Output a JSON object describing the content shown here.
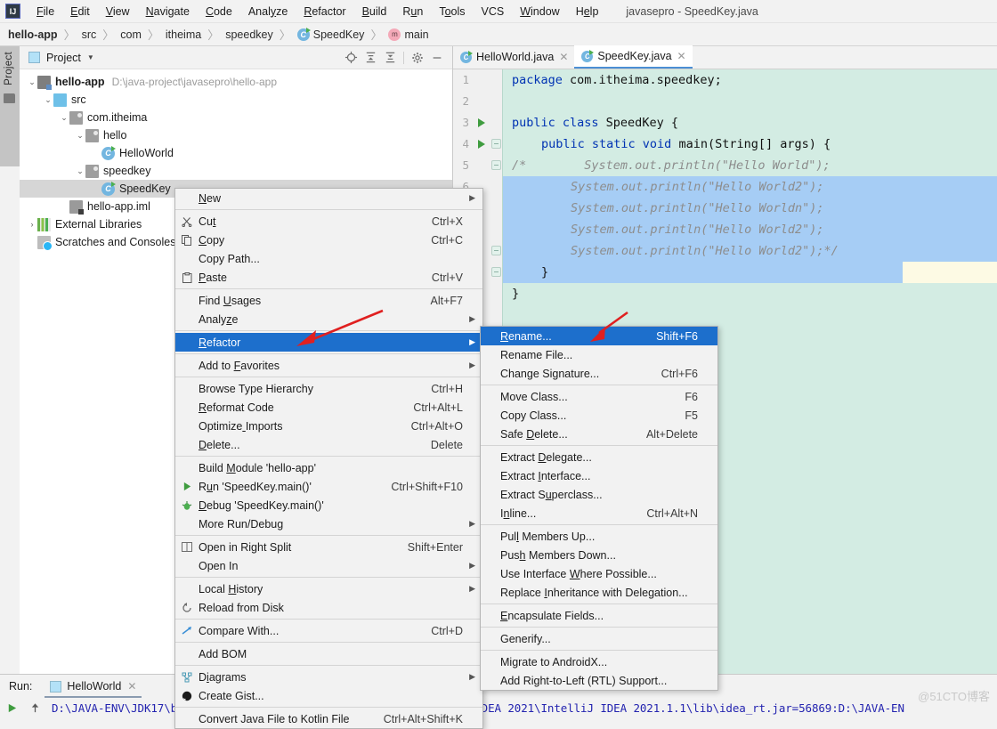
{
  "window": {
    "title": "javasepro - SpeedKey.java",
    "logo_text": "IJ"
  },
  "menubar": {
    "items": [
      {
        "label": "File"
      },
      {
        "label": "Edit"
      },
      {
        "label": "View"
      },
      {
        "label": "Navigate"
      },
      {
        "label": "Code"
      },
      {
        "label": "Analyze"
      },
      {
        "label": "Refactor"
      },
      {
        "label": "Build"
      },
      {
        "label": "Run"
      },
      {
        "label": "Tools"
      },
      {
        "label": "VCS"
      },
      {
        "label": "Window"
      },
      {
        "label": "Help"
      }
    ]
  },
  "breadcrumb": {
    "items": [
      {
        "label": "hello-app",
        "icon": "none",
        "bold": true
      },
      {
        "label": "src",
        "icon": "none",
        "bold": false
      },
      {
        "label": "com",
        "icon": "none",
        "bold": false
      },
      {
        "label": "itheima",
        "icon": "none",
        "bold": false
      },
      {
        "label": "speedkey",
        "icon": "none",
        "bold": false
      },
      {
        "label": "SpeedKey",
        "icon": "class-icon",
        "bold": false
      },
      {
        "label": "main",
        "icon": "method-icon",
        "bold": false
      }
    ]
  },
  "toolwindow_strip": {
    "project_label": "Project"
  },
  "project_panel": {
    "title": "Project",
    "caret": "▼",
    "tools": [
      {
        "name": "locate-icon",
        "glyph": "⊕"
      },
      {
        "name": "expand-all-icon",
        "glyph": "⧉"
      },
      {
        "name": "collapse-all-icon",
        "glyph": "⧉"
      },
      {
        "name": "settings-gear-icon",
        "glyph": "⚙"
      },
      {
        "name": "hide-icon",
        "glyph": "—"
      }
    ],
    "tree": [
      {
        "label": "hello-app",
        "path": "D:\\java-project\\javasepro\\hello-app",
        "indent": 0,
        "arrow": "⌄",
        "icon": "module-folder-icon",
        "bold": true,
        "selected": false
      },
      {
        "label": "src",
        "path": "",
        "indent": 1,
        "arrow": "⌄",
        "icon": "source-folder-icon",
        "bold": false,
        "selected": false
      },
      {
        "label": "com.itheima",
        "path": "",
        "indent": 2,
        "arrow": "⌄",
        "icon": "package-icon",
        "bold": false,
        "selected": false
      },
      {
        "label": "hello",
        "path": "",
        "indent": 3,
        "arrow": "⌄",
        "icon": "package-icon",
        "bold": false,
        "selected": false
      },
      {
        "label": "HelloWorld",
        "path": "",
        "indent": 4,
        "arrow": "",
        "icon": "class-icon",
        "bold": false,
        "selected": false
      },
      {
        "label": "speedkey",
        "path": "",
        "indent": 3,
        "arrow": "⌄",
        "icon": "package-icon",
        "bold": false,
        "selected": false
      },
      {
        "label": "SpeedKey",
        "path": "",
        "indent": 4,
        "arrow": "",
        "icon": "class-icon",
        "bold": false,
        "selected": true
      },
      {
        "label": "hello-app.iml",
        "path": "",
        "indent": 2,
        "arrow": "",
        "icon": "iml-file-icon",
        "bold": false,
        "selected": false
      },
      {
        "label": "External Libraries",
        "path": "",
        "indent": 0,
        "arrow": "›",
        "icon": "libraries-icon",
        "bold": false,
        "selected": false
      },
      {
        "label": "Scratches and Consoles",
        "path": "",
        "indent": 0,
        "arrow": "",
        "icon": "scratches-icon",
        "bold": false,
        "selected": false
      }
    ]
  },
  "editor": {
    "tabs": [
      {
        "label": "HelloWorld.java",
        "active": false,
        "icon": "class-icon"
      },
      {
        "label": "SpeedKey.java",
        "active": true,
        "icon": "class-icon"
      }
    ],
    "line_numbers": [
      "1",
      "2",
      "3",
      "4",
      "5",
      "6"
    ],
    "code": [
      {
        "n": 1,
        "segments": [
          {
            "t": "package",
            "c": "kw"
          },
          {
            "t": " com.itheima.speedkey;",
            "c": "plain"
          }
        ],
        "indent": 0
      },
      {
        "n": 2,
        "segments": [],
        "indent": 0
      },
      {
        "n": 3,
        "segments": [
          {
            "t": "public class",
            "c": "kw"
          },
          {
            "t": " SpeedKey {",
            "c": "plain"
          }
        ],
        "indent": 0
      },
      {
        "n": 4,
        "segments": [
          {
            "t": "public static void",
            "c": "kw"
          },
          {
            "t": " ",
            "c": "plain"
          },
          {
            "t": "main",
            "c": "plain"
          },
          {
            "t": "(String[] args) {",
            "c": "plain"
          }
        ],
        "indent": 1
      },
      {
        "n": 5,
        "segments": [
          {
            "t": "/*        System.out.println(\"Hello World\");",
            "c": "cmt"
          }
        ],
        "indent": 0
      },
      {
        "n": 6,
        "segments": [
          {
            "t": "System.out.println(\"Hello World2\");",
            "c": "cmt"
          }
        ],
        "indent": 2
      },
      {
        "n": 7,
        "segments": [
          {
            "t": "System.out.println(\"Hello Worldn\");",
            "c": "cmt"
          }
        ],
        "indent": 2
      },
      {
        "n": 8,
        "segments": [
          {
            "t": "System.out.println(\"Hello World2\");",
            "c": "cmt"
          }
        ],
        "indent": 2
      },
      {
        "n": 9,
        "segments": [
          {
            "t": "System.out.println(\"Hello World2\");*/",
            "c": "cmt"
          }
        ],
        "indent": 2
      },
      {
        "n": 10,
        "segments": [
          {
            "t": "}",
            "c": "plain"
          }
        ],
        "indent": 1
      },
      {
        "n": 11,
        "segments": [
          {
            "t": "}",
            "c": "plain"
          }
        ],
        "indent": 0
      }
    ]
  },
  "context_menu": {
    "items": [
      {
        "label": "New",
        "accel": "",
        "icon": "",
        "arrow": true,
        "sep_after": true,
        "highlight": false,
        "mn": 0
      },
      {
        "label": "Cut",
        "accel": "Ctrl+X",
        "icon": "✂",
        "arrow": false,
        "sep_after": false,
        "highlight": false,
        "mn": 2
      },
      {
        "label": "Copy",
        "accel": "Ctrl+C",
        "icon": "❐",
        "arrow": false,
        "sep_after": false,
        "highlight": false,
        "mn": 0
      },
      {
        "label": "Copy Path...",
        "accel": "",
        "icon": "",
        "arrow": false,
        "sep_after": false,
        "highlight": false,
        "mn": -1
      },
      {
        "label": "Paste",
        "accel": "Ctrl+V",
        "icon": "⎘",
        "arrow": false,
        "sep_after": true,
        "highlight": false,
        "mn": 0
      },
      {
        "label": "Find Usages",
        "accel": "Alt+F7",
        "icon": "",
        "arrow": false,
        "sep_after": false,
        "highlight": false,
        "mn": 5
      },
      {
        "label": "Analyze",
        "accel": "",
        "icon": "",
        "arrow": true,
        "sep_after": true,
        "highlight": false,
        "mn": 5
      },
      {
        "label": "Refactor",
        "accel": "",
        "icon": "",
        "arrow": true,
        "sep_after": true,
        "highlight": true,
        "mn": 0
      },
      {
        "label": "Add to Favorites",
        "accel": "",
        "icon": "",
        "arrow": true,
        "sep_after": true,
        "highlight": false,
        "mn": 7
      },
      {
        "label": "Browse Type Hierarchy",
        "accel": "Ctrl+H",
        "icon": "",
        "arrow": false,
        "sep_after": false,
        "highlight": false,
        "mn": -1
      },
      {
        "label": "Reformat Code",
        "accel": "Ctrl+Alt+L",
        "icon": "",
        "arrow": false,
        "sep_after": false,
        "highlight": false,
        "mn": 0
      },
      {
        "label": "Optimize Imports",
        "accel": "Ctrl+Alt+O",
        "icon": "",
        "arrow": false,
        "sep_after": false,
        "highlight": false,
        "mn": 8
      },
      {
        "label": "Delete...",
        "accel": "Delete",
        "icon": "",
        "arrow": false,
        "sep_after": true,
        "highlight": false,
        "mn": 0
      },
      {
        "label": "Build Module 'hello-app'",
        "accel": "",
        "icon": "",
        "arrow": false,
        "sep_after": false,
        "highlight": false,
        "mn": 6
      },
      {
        "label": "Run 'SpeedKey.main()'",
        "accel": "Ctrl+Shift+F10",
        "icon": "run-icon",
        "arrow": false,
        "sep_after": false,
        "highlight": false,
        "mn": 1
      },
      {
        "label": "Debug 'SpeedKey.main()'",
        "accel": "",
        "icon": "debug-icon",
        "arrow": false,
        "sep_after": false,
        "highlight": false,
        "mn": 0
      },
      {
        "label": "More Run/Debug",
        "accel": "",
        "icon": "",
        "arrow": true,
        "sep_after": true,
        "highlight": false,
        "mn": -1
      },
      {
        "label": "Open in Right Split",
        "accel": "Shift+Enter",
        "icon": "split-icon",
        "arrow": false,
        "sep_after": false,
        "highlight": false,
        "mn": -1
      },
      {
        "label": "Open In",
        "accel": "",
        "icon": "",
        "arrow": true,
        "sep_after": true,
        "highlight": false,
        "mn": -1
      },
      {
        "label": "Local History",
        "accel": "",
        "icon": "",
        "arrow": true,
        "sep_after": false,
        "highlight": false,
        "mn": 6
      },
      {
        "label": "Reload from Disk",
        "accel": "",
        "icon": "reload-icon",
        "arrow": false,
        "sep_after": true,
        "highlight": false,
        "mn": -1
      },
      {
        "label": "Compare With...",
        "accel": "Ctrl+D",
        "icon": "compare-icon",
        "arrow": false,
        "sep_after": true,
        "highlight": false,
        "mn": -1
      },
      {
        "label": "Add BOM",
        "accel": "",
        "icon": "",
        "arrow": false,
        "sep_after": true,
        "highlight": false,
        "mn": -1
      },
      {
        "label": "Diagrams",
        "accel": "",
        "icon": "diagram-icon",
        "arrow": true,
        "sep_after": false,
        "highlight": false,
        "mn": 1
      },
      {
        "label": "Create Gist...",
        "accel": "",
        "icon": "github-icon",
        "arrow": false,
        "sep_after": true,
        "highlight": false,
        "mn": -1
      },
      {
        "label": "Convert Java File to Kotlin File",
        "accel": "Ctrl+Alt+Shift+K",
        "icon": "",
        "arrow": false,
        "sep_after": false,
        "highlight": false,
        "mn": -1
      }
    ]
  },
  "refactor_submenu": {
    "items": [
      {
        "label": "Rename...",
        "accel": "Shift+F6",
        "arrow": false,
        "sep_after": false,
        "highlight": true,
        "mn": 0
      },
      {
        "label": "Rename File...",
        "accel": "",
        "arrow": false,
        "sep_after": false,
        "highlight": false,
        "mn": -1
      },
      {
        "label": "Change Signature...",
        "accel": "Ctrl+F6",
        "arrow": false,
        "sep_after": true,
        "highlight": false,
        "mn": 9
      },
      {
        "label": "Move Class...",
        "accel": "F6",
        "arrow": false,
        "sep_after": false,
        "highlight": false,
        "mn": -1
      },
      {
        "label": "Copy Class...",
        "accel": "F5",
        "arrow": false,
        "sep_after": false,
        "highlight": false,
        "mn": -1
      },
      {
        "label": "Safe Delete...",
        "accel": "Alt+Delete",
        "arrow": false,
        "sep_after": true,
        "highlight": false,
        "mn": 5
      },
      {
        "label": "Extract Delegate...",
        "accel": "",
        "arrow": false,
        "sep_after": false,
        "highlight": false,
        "mn": 8
      },
      {
        "label": "Extract Interface...",
        "accel": "",
        "arrow": false,
        "sep_after": false,
        "highlight": false,
        "mn": 8
      },
      {
        "label": "Extract Superclass...",
        "accel": "",
        "arrow": false,
        "sep_after": false,
        "highlight": false,
        "mn": 9
      },
      {
        "label": "Inline...",
        "accel": "Ctrl+Alt+N",
        "arrow": false,
        "sep_after": true,
        "highlight": false,
        "mn": 1
      },
      {
        "label": "Pull Members Up...",
        "accel": "",
        "arrow": false,
        "sep_after": false,
        "highlight": false,
        "mn": 3
      },
      {
        "label": "Push Members Down...",
        "accel": "",
        "arrow": false,
        "sep_after": false,
        "highlight": false,
        "mn": 3
      },
      {
        "label": "Use Interface Where Possible...",
        "accel": "",
        "arrow": false,
        "sep_after": false,
        "highlight": false,
        "mn": 14
      },
      {
        "label": "Replace Inheritance with Delegation...",
        "accel": "",
        "arrow": false,
        "sep_after": true,
        "highlight": false,
        "mn": 8
      },
      {
        "label": "Encapsulate Fields...",
        "accel": "",
        "arrow": false,
        "sep_after": true,
        "highlight": false,
        "mn": 0
      },
      {
        "label": "Generify...",
        "accel": "",
        "arrow": false,
        "sep_after": true,
        "highlight": false,
        "mn": -1
      },
      {
        "label": "Migrate to AndroidX...",
        "accel": "",
        "arrow": false,
        "sep_after": false,
        "highlight": false,
        "mn": -1
      },
      {
        "label": "Add Right-to-Left (RTL) Support...",
        "accel": "",
        "arrow": false,
        "sep_after": false,
        "highlight": false,
        "mn": -1
      }
    ]
  },
  "run_panel": {
    "label": "Run:",
    "tabs": [
      {
        "label": "HelloWorld",
        "active": true
      }
    ],
    "console_line": "D:\\JAVA-ENV\\JDK17\\bin\\java.exe \"-javaagent:D:\\JAVA-ENV\\IntelliJ IDEA 2021\\IntelliJ IDEA 2021.1.1\\lib\\idea_rt.jar=56869:D:\\JAVA-EN"
  },
  "watermark": "@51CTO博客",
  "colors": {
    "menu_highlight": "#1d6fcc",
    "editor_bg": "#d3ece3",
    "selection_bg": "#a6cdf5",
    "caret_line_bg": "#fdfae4",
    "annotation_arrow": "#e02020",
    "keyword": "#0033b3",
    "comment": "#8d8d8d",
    "console_text": "#2424b0"
  }
}
